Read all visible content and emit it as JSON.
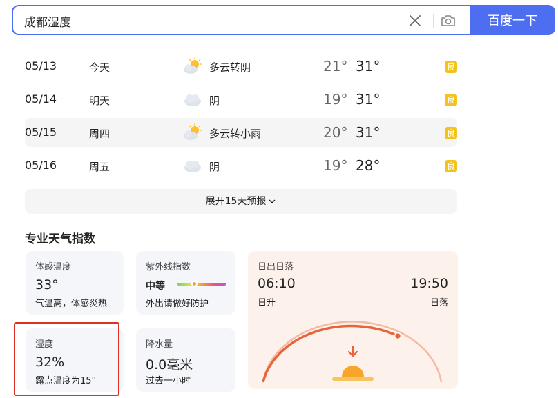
{
  "search": {
    "query": "成都湿度",
    "button_label": "百度一下"
  },
  "forecast": [
    {
      "date": "05/13",
      "weekday": "今天",
      "icon": "partly-cloudy-icon",
      "desc": "多云转阴",
      "low": "21°",
      "high": "31°",
      "aqi": "良"
    },
    {
      "date": "05/14",
      "weekday": "明天",
      "icon": "cloud-icon",
      "desc": "阴",
      "low": "19°",
      "high": "31°",
      "aqi": "良"
    },
    {
      "date": "05/15",
      "weekday": "周四",
      "icon": "partly-cloudy-icon",
      "desc": "多云转小雨",
      "low": "20°",
      "high": "31°",
      "aqi": "良"
    },
    {
      "date": "05/16",
      "weekday": "周五",
      "icon": "cloud-icon",
      "desc": "阴",
      "low": "19°",
      "high": "28°",
      "aqi": "良"
    }
  ],
  "expand_label": "展开15天预报",
  "section_title": "专业天气指数",
  "indices": {
    "feels_like": {
      "label": "体感温度",
      "value": "33°",
      "sub": "气温高，体感炎热"
    },
    "uv": {
      "label": "紫外线指数",
      "level": "中等",
      "sub": "外出请做好防护",
      "fraction": 0.35
    },
    "humidity": {
      "label": "湿度",
      "value": "32%",
      "sub": "露点温度为15°"
    },
    "precip": {
      "label": "降水量",
      "value": "0.0毫米",
      "sub": "过去一小时"
    },
    "sun": {
      "label": "日出日落",
      "sunrise_time": "06:10",
      "sunrise_label": "日升",
      "sunset_time": "19:50",
      "sunset_label": "日落"
    }
  },
  "colors": {
    "accent": "#4e6ef2",
    "aqi_good": "#f4c21b",
    "highlight": "#e02e24",
    "sun_arc": "#e8643a"
  }
}
